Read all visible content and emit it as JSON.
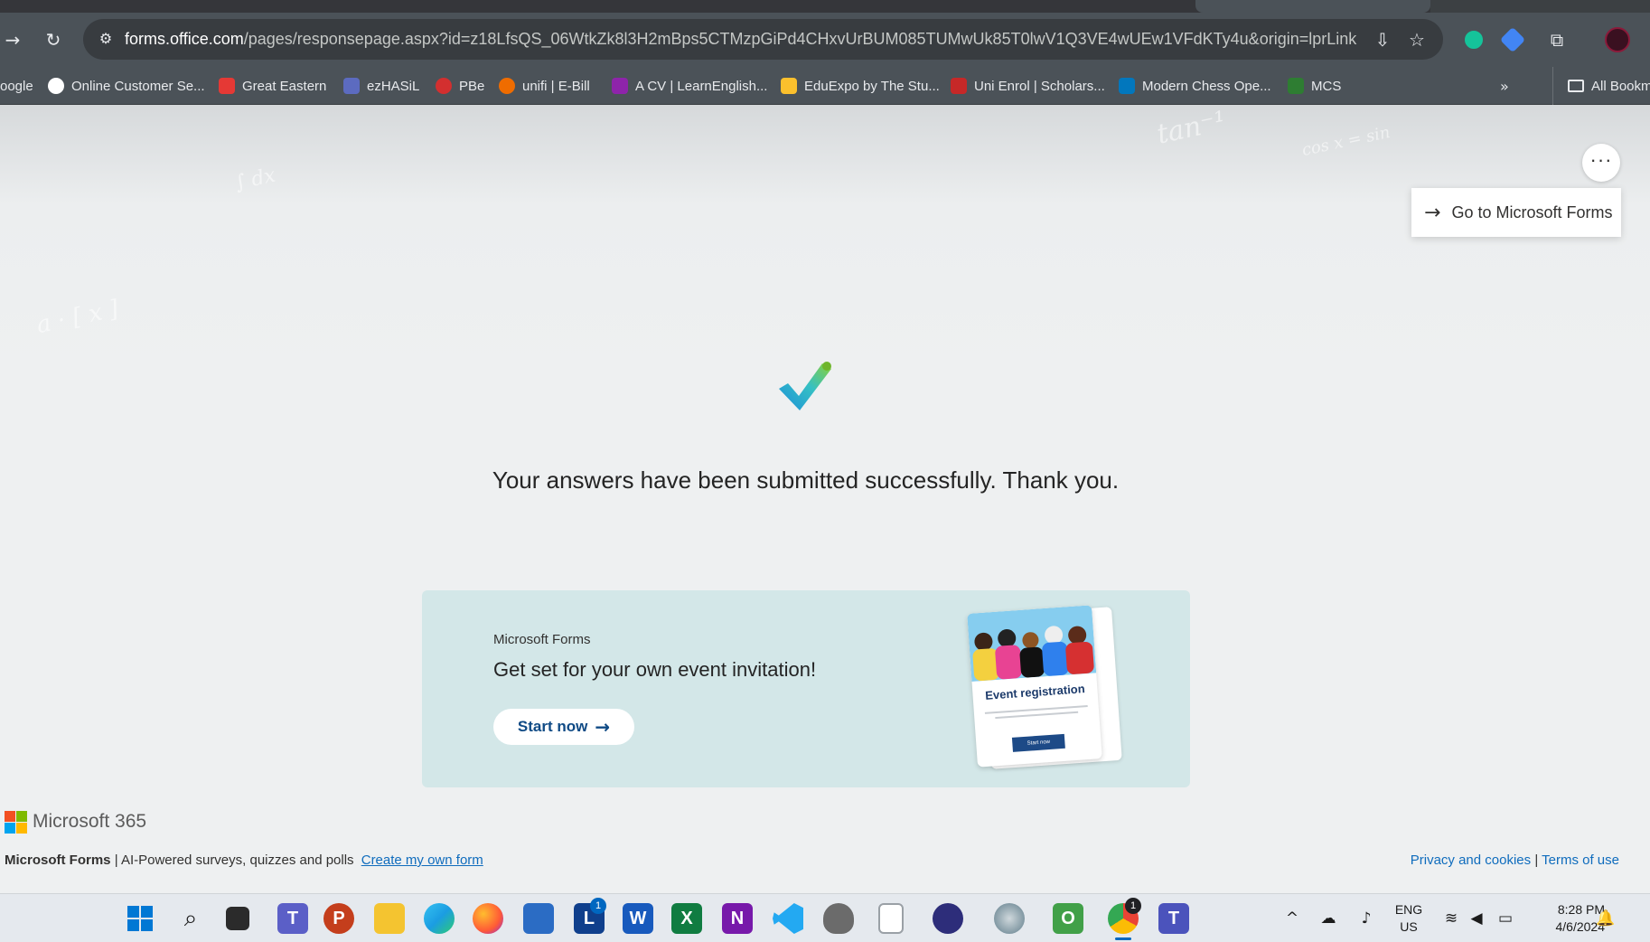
{
  "browser": {
    "url_host": "forms.office.com",
    "url_path": "/pages/responsepage.aspx?id=z18LfsQS_06WtkZk8l3H2mBps5CTMzpGiPd4CHxvUrBUM085TUMwUk85T0lwV1Q3VE4wUEw1VFdKTy4u&origin=lprLink",
    "bookmarks": [
      {
        "label": "oogle",
        "color": "#ffffff"
      },
      {
        "label": "Online Customer Se...",
        "color": "#ffffff"
      },
      {
        "label": "Great Eastern",
        "color": "#e53935"
      },
      {
        "label": "ezHASiL",
        "color": "#5c6bc0"
      },
      {
        "label": "PBe",
        "color": "#d32f2f"
      },
      {
        "label": "unifi | E-Bill",
        "color": "#ef6c00"
      },
      {
        "label": "A CV | LearnEnglish...",
        "color": "#8e24aa"
      },
      {
        "label": "EduExpo by The Stu...",
        "color": "#fbc02d"
      },
      {
        "label": "Uni Enrol | Scholars...",
        "color": "#c62828"
      },
      {
        "label": "Modern Chess Ope...",
        "color": "#0277bd"
      },
      {
        "label": "MCS",
        "color": "#2e7d32"
      },
      {
        "label": "All Bookmarks",
        "color": "#e8eaed"
      }
    ]
  },
  "page": {
    "goto_forms": "Go to Microsoft Forms",
    "confirmation": "Your answers have been submitted successfully. Thank you.",
    "promo": {
      "eyebrow": "Microsoft Forms",
      "headline": "Get set for your own event invitation!",
      "button": "Start now",
      "card_title": "Event registration",
      "card_button": "Start now"
    },
    "brand": "Microsoft 365",
    "footer": {
      "product": "Microsoft Forms",
      "separator": "|",
      "tagline": "AI-Powered surveys, quizzes and polls",
      "create_link": "Create my own form",
      "privacy": "Privacy and cookies",
      "terms": "Terms of use"
    }
  },
  "taskbar": {
    "launcher_badge": "1",
    "chrome_badge": "1",
    "lang_line1": "ENG",
    "lang_line2": "US",
    "time": "8:28 PM",
    "date": "4/6/2024"
  },
  "colors": {
    "accent": "#0f6cbd",
    "promo_bg": "#d3e7e8",
    "button_text": "#0f4a85"
  }
}
